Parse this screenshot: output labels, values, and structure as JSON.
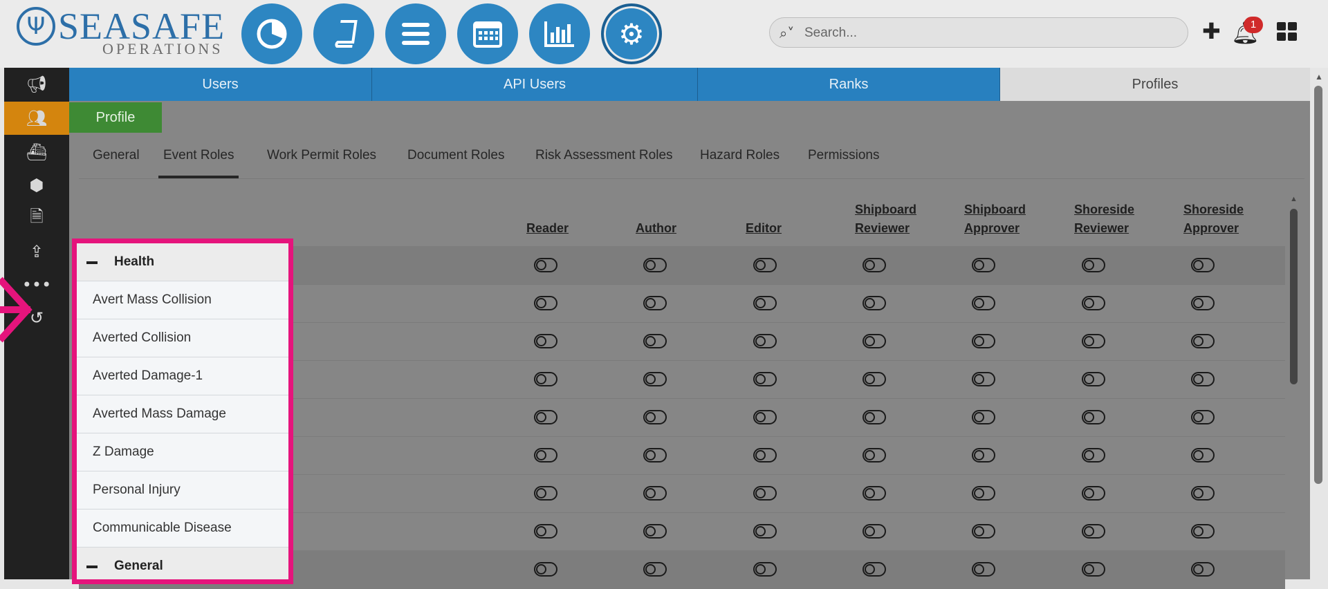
{
  "logo": {
    "brand": "SEASAFE",
    "sub": "OPERATIONS"
  },
  "nav_circles": [
    "dashboard-icon",
    "book-icon",
    "menu-icon",
    "calendar-icon",
    "bar-chart-icon",
    "gear-icon"
  ],
  "search": {
    "placeholder": "Search..."
  },
  "notifications": {
    "count": "1"
  },
  "top_tabs": [
    {
      "label": "Users"
    },
    {
      "label": "API Users"
    },
    {
      "label": "Ranks"
    },
    {
      "label": "Profiles"
    }
  ],
  "profile_tab": "Profile",
  "sub_tabs": [
    {
      "label": "General"
    },
    {
      "label": "Event Roles"
    },
    {
      "label": "Work Permit Roles"
    },
    {
      "label": "Document Roles"
    },
    {
      "label": "Risk Assessment Roles"
    },
    {
      "label": "Hazard Roles"
    },
    {
      "label": "Permissions"
    }
  ],
  "columns": [
    {
      "line1": "Reader",
      "line2": ""
    },
    {
      "line1": "Author",
      "line2": ""
    },
    {
      "line1": "Editor",
      "line2": ""
    },
    {
      "line1": "Shipboard",
      "line2": "Reviewer"
    },
    {
      "line1": "Shipboard",
      "line2": "Approver"
    },
    {
      "line1": "Shoreside",
      "line2": "Reviewer"
    },
    {
      "line1": "Shoreside",
      "line2": "Approver"
    }
  ],
  "rows": [
    {
      "label": "Health",
      "group": true
    },
    {
      "label": "Avert Mass Collision",
      "group": false
    },
    {
      "label": "Averted Collision",
      "group": false
    },
    {
      "label": "Averted Damage-1",
      "group": false
    },
    {
      "label": "Averted Mass Damage",
      "group": false
    },
    {
      "label": "Z Damage",
      "group": false
    },
    {
      "label": "Personal Injury",
      "group": false
    },
    {
      "label": "Communicable Disease",
      "group": false
    },
    {
      "label": "General",
      "group": true
    }
  ],
  "colors": {
    "accent_blue": "#2880bf",
    "highlight_pink": "#e5147c",
    "profile_green": "#3e8a34",
    "sidebar_active": "#d4850e"
  }
}
